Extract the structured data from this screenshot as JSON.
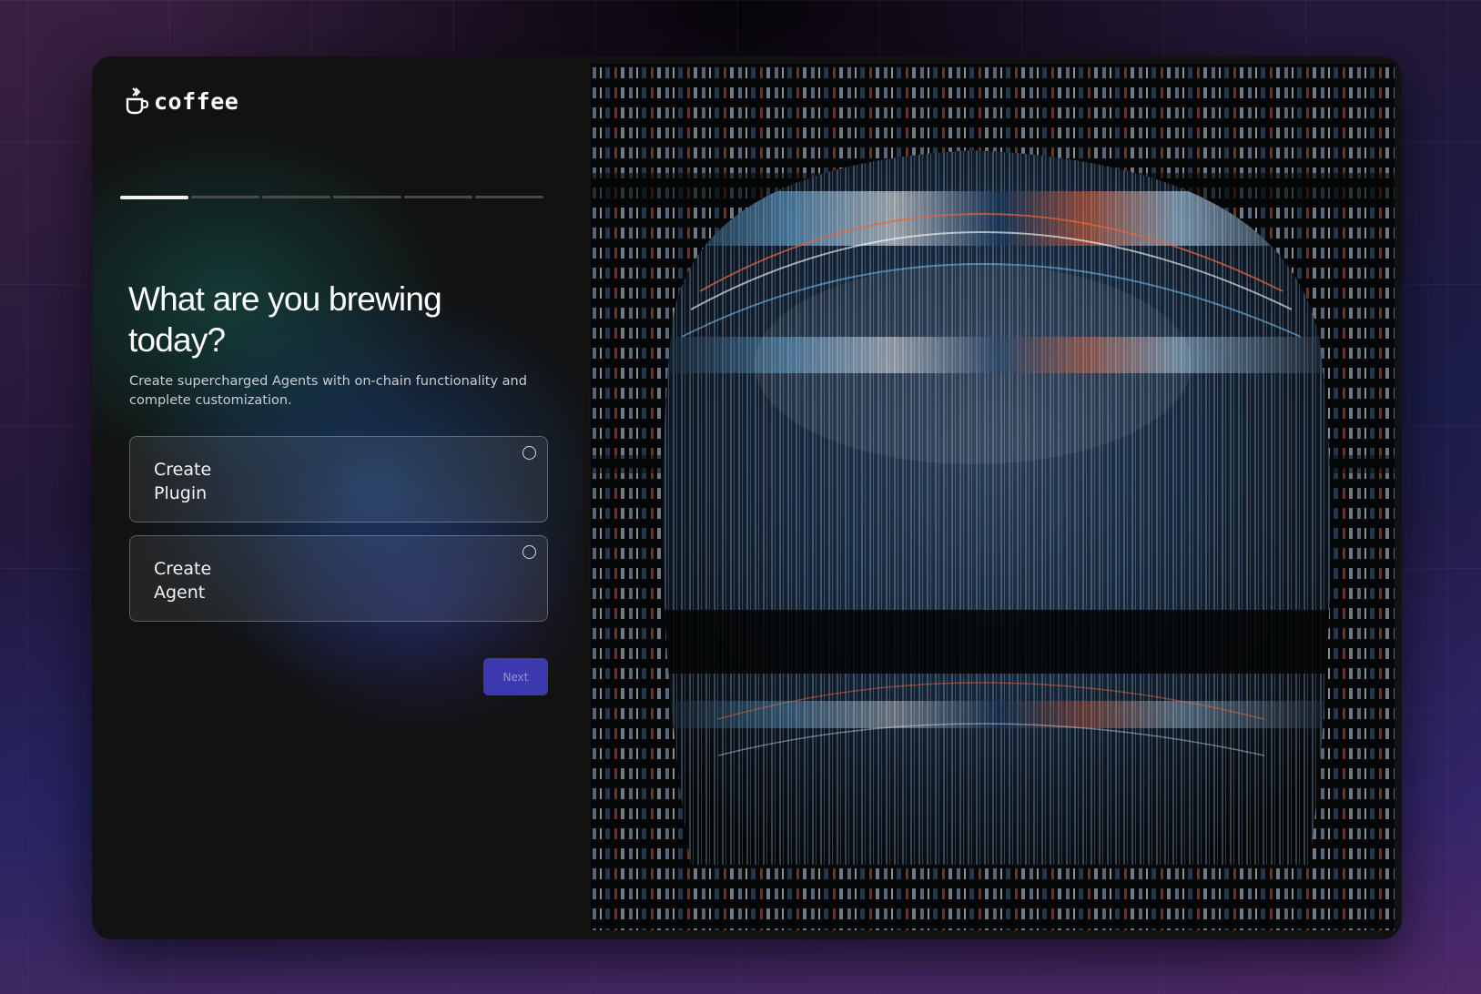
{
  "brand": {
    "name": "coffee",
    "icon": "coffee-cup-icon"
  },
  "progress": {
    "total_steps": 6,
    "current_step": 1
  },
  "heading": {
    "title": "What are you brewing today?",
    "subtitle": "Create supercharged Agents with on-chain functionality and complete customization."
  },
  "options": [
    {
      "label": "Create Plugin",
      "selected": false
    },
    {
      "label": "Create Agent",
      "selected": false
    }
  ],
  "actions": {
    "next_label": "Next"
  },
  "colors": {
    "card_background": "#121212",
    "primary_button": "#3d3ab0",
    "progress_active": "#f2f2f2",
    "progress_inactive": "#4a4a4a"
  },
  "hero": {
    "icon": "abstract-glitch-artwork"
  }
}
